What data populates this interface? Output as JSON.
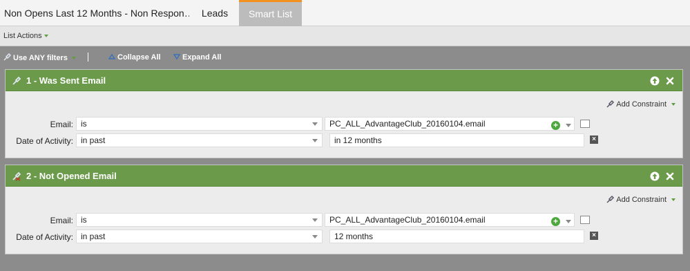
{
  "tabs": {
    "title": "Non Opens Last 12 Months - Non Respon…",
    "leads": "Leads",
    "smart_list": "Smart List"
  },
  "list_actions": "List Actions",
  "filterbar": {
    "use_any": "Use ANY filters",
    "collapse_all": "Collapse All",
    "expand_all": "Expand All"
  },
  "groups": [
    {
      "title": "1 - Was Sent Email",
      "add_constraint": "Add Constraint",
      "rows": [
        {
          "label": "Email:",
          "operator": "is",
          "value": "PC_ALL_AdvantageClub_20160104.email"
        },
        {
          "label": "Date of Activity:",
          "operator": "in past",
          "value": "in 12 months"
        }
      ]
    },
    {
      "title": "2 - Not Opened Email",
      "add_constraint": "Add Constraint",
      "rows": [
        {
          "label": "Email:",
          "operator": "is",
          "value": "PC_ALL_AdvantageClub_20160104.email"
        },
        {
          "label": "Date of Activity:",
          "operator": "in past",
          "value": "12 months"
        }
      ]
    }
  ],
  "colors": {
    "accent_orange": "#f29120",
    "group_header_green": "#6b9a4b",
    "caret_green": "#5e9e3f"
  },
  "icons": {
    "filter": "filter-icon",
    "collapse": "collapse-triangle-icon",
    "expand": "expand-triangle-icon",
    "move_up": "arrow-up-icon",
    "remove": "close-icon",
    "add": "plus-circle-icon",
    "browse": "browse-icon",
    "delete_row": "delete-row-icon"
  }
}
